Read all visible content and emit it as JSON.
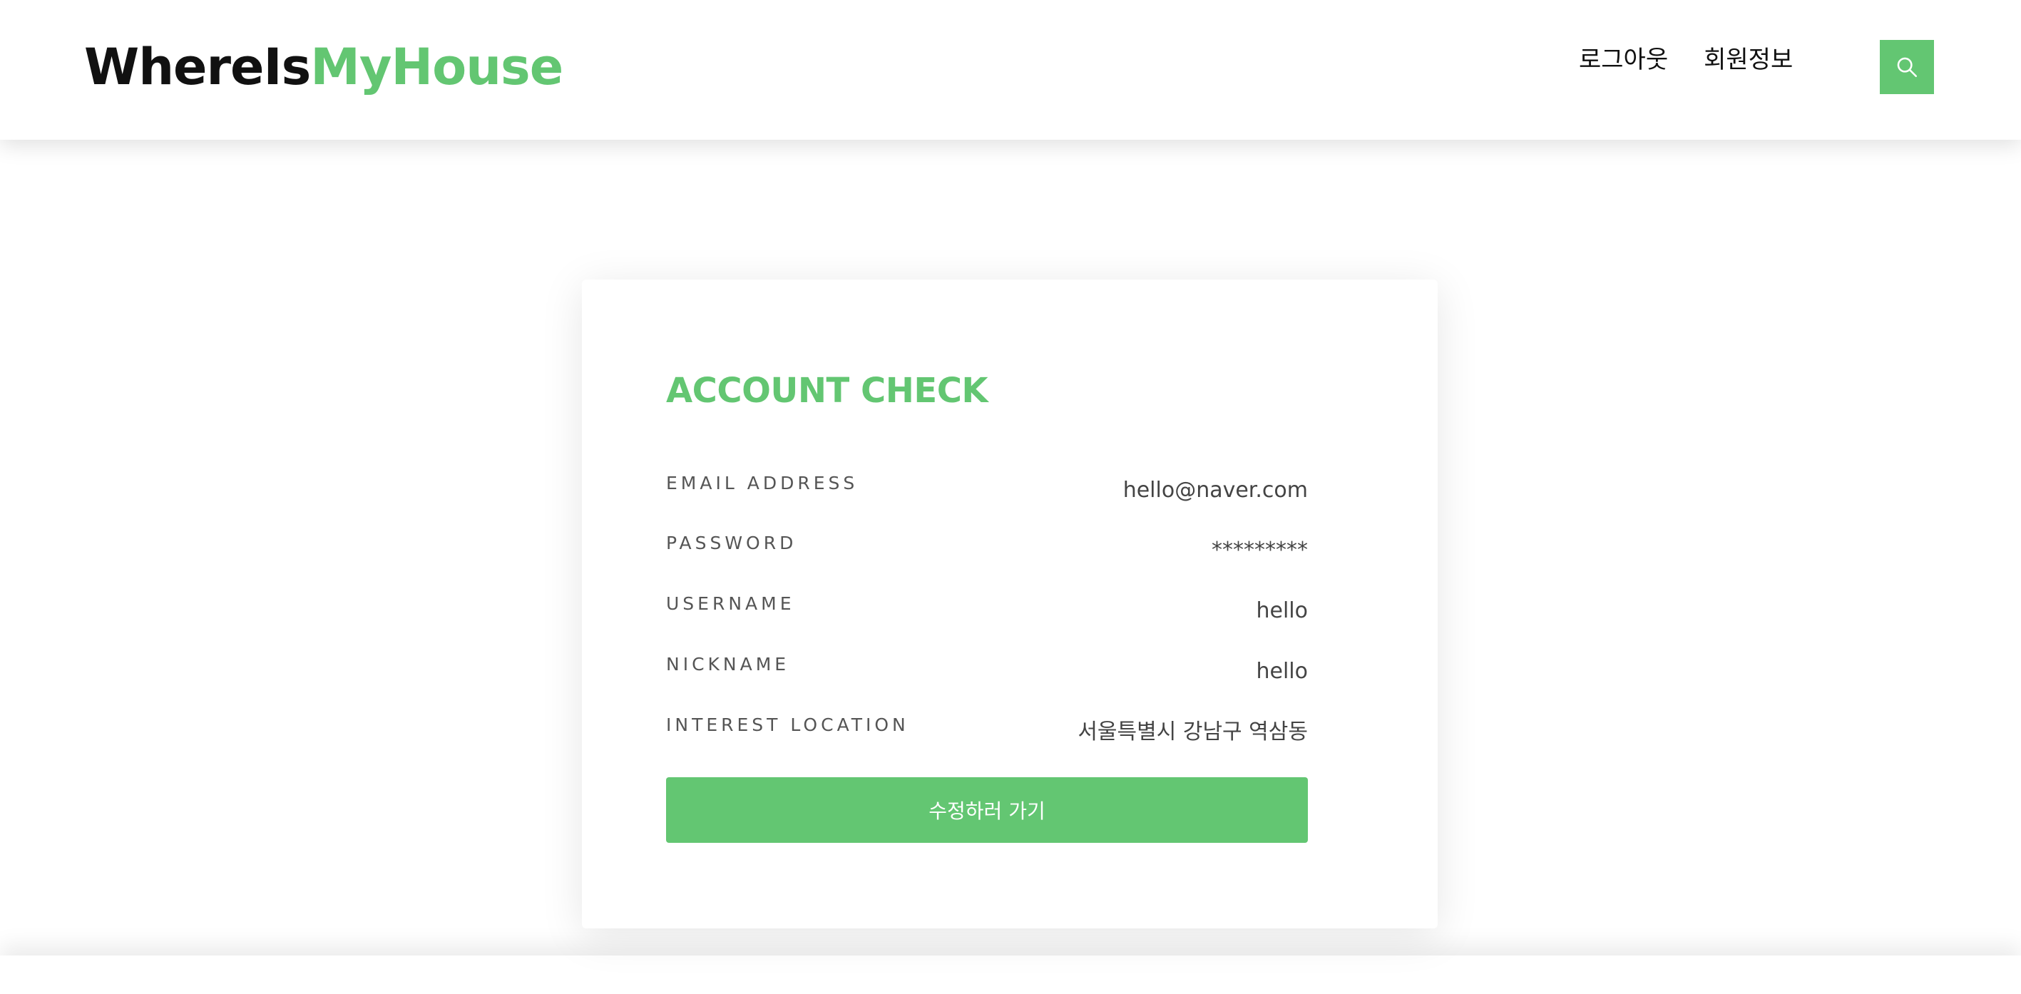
{
  "header": {
    "brand_part1": "WhereIs",
    "brand_part2": "MyHouse",
    "nav": [
      {
        "label": "로그아웃"
      },
      {
        "label": "회원정보"
      }
    ],
    "search_icon": "search-icon"
  },
  "card": {
    "title": "ACCOUNT CHECK",
    "rows": [
      {
        "label": "EMAIL ADDRESS",
        "value": "hello@naver.com"
      },
      {
        "label": "PASSWORD",
        "value": "*********"
      },
      {
        "label": "USERNAME",
        "value": "hello"
      },
      {
        "label": "NICKNAME",
        "value": "hello"
      },
      {
        "label": "INTEREST LOCATION",
        "value": "서울특별시 강남구 역삼동"
      }
    ],
    "edit_button_label": "수정하러 가기"
  },
  "colors": {
    "accent": "#63c672",
    "text_dark": "#111111",
    "label_gray": "#555555"
  }
}
